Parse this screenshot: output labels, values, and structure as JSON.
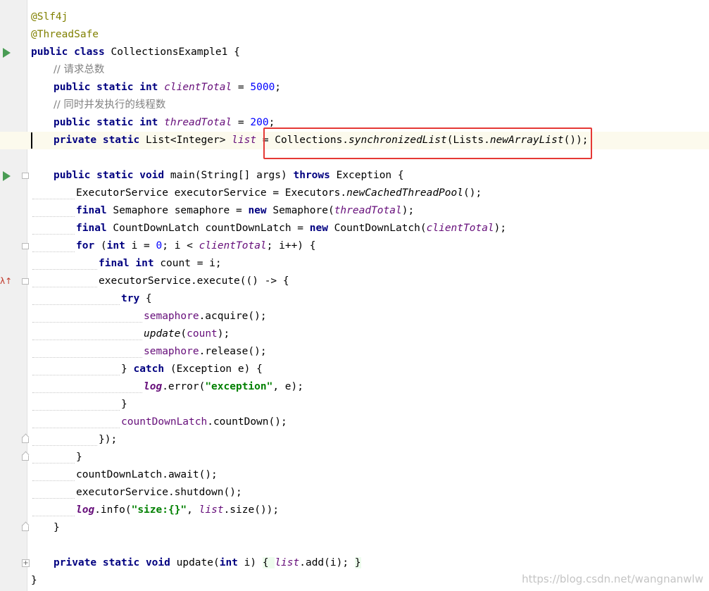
{
  "editor": {
    "lines": [
      {
        "indent": 0,
        "gutter": "",
        "tokens": [
          {
            "t": "anno",
            "v": "@Slf4j"
          }
        ]
      },
      {
        "indent": 0,
        "gutter": "",
        "tokens": [
          {
            "t": "anno",
            "v": "@ThreadSafe"
          }
        ]
      },
      {
        "indent": 0,
        "gutter": "run",
        "tokens": [
          {
            "t": "kw",
            "v": "public class "
          },
          {
            "t": "p",
            "v": "CollectionsExample1 {"
          }
        ]
      },
      {
        "indent": 1,
        "gutter": "",
        "tokens": [
          {
            "t": "cm",
            "v": "// 请求总数"
          }
        ]
      },
      {
        "indent": 1,
        "gutter": "",
        "tokens": [
          {
            "t": "kw",
            "v": "public static int "
          },
          {
            "t": "field",
            "v": "clientTotal"
          },
          {
            "t": "p",
            "v": " = "
          },
          {
            "t": "num",
            "v": "5000"
          },
          {
            "t": "p",
            "v": ";"
          }
        ]
      },
      {
        "indent": 1,
        "gutter": "",
        "tokens": [
          {
            "t": "cm",
            "v": "// 同时并发执行的线程数"
          }
        ]
      },
      {
        "indent": 1,
        "gutter": "",
        "tokens": [
          {
            "t": "kw",
            "v": "public static int "
          },
          {
            "t": "field",
            "v": "threadTotal"
          },
          {
            "t": "p",
            "v": " = "
          },
          {
            "t": "num",
            "v": "200"
          },
          {
            "t": "p",
            "v": ";"
          }
        ]
      },
      {
        "indent": 1,
        "gutter": "",
        "current": true,
        "tokens": [
          {
            "t": "kw",
            "v": "private static "
          },
          {
            "t": "p",
            "v": "List<Integer> "
          },
          {
            "t": "field",
            "v": "list"
          },
          {
            "t": "p",
            "v": " = Collections."
          },
          {
            "t": "static",
            "v": "synchronizedList"
          },
          {
            "t": "p",
            "v": "(Lists."
          },
          {
            "t": "static",
            "v": "newArrayList"
          },
          {
            "t": "p",
            "v": "());"
          }
        ]
      },
      {
        "indent": 0,
        "gutter": "",
        "tokens": []
      },
      {
        "indent": 1,
        "gutter": "run-fold",
        "tokens": [
          {
            "t": "kw",
            "v": "public static void "
          },
          {
            "t": "p",
            "v": "main(String[] args) "
          },
          {
            "t": "kw",
            "v": "throws "
          },
          {
            "t": "p",
            "v": "Exception {"
          }
        ]
      },
      {
        "indent": 2,
        "gutter": "",
        "guide": true,
        "tokens": [
          {
            "t": "p",
            "v": "ExecutorService executorService = Executors."
          },
          {
            "t": "static",
            "v": "newCachedThreadPool"
          },
          {
            "t": "p",
            "v": "();"
          }
        ]
      },
      {
        "indent": 2,
        "gutter": "",
        "guide": true,
        "tokens": [
          {
            "t": "kw",
            "v": "final "
          },
          {
            "t": "p",
            "v": "Semaphore semaphore = "
          },
          {
            "t": "kw",
            "v": "new "
          },
          {
            "t": "p",
            "v": "Semaphore("
          },
          {
            "t": "field",
            "v": "threadTotal"
          },
          {
            "t": "p",
            "v": ");"
          }
        ]
      },
      {
        "indent": 2,
        "gutter": "",
        "guide": true,
        "tokens": [
          {
            "t": "kw",
            "v": "final "
          },
          {
            "t": "p",
            "v": "CountDownLatch countDownLatch = "
          },
          {
            "t": "kw",
            "v": "new "
          },
          {
            "t": "p",
            "v": "CountDownLatch("
          },
          {
            "t": "field",
            "v": "clientTotal"
          },
          {
            "t": "p",
            "v": ");"
          }
        ]
      },
      {
        "indent": 2,
        "gutter": "fold",
        "guide": true,
        "tokens": [
          {
            "t": "kw",
            "v": "for "
          },
          {
            "t": "p",
            "v": "("
          },
          {
            "t": "kw",
            "v": "int "
          },
          {
            "t": "p",
            "v": "i = "
          },
          {
            "t": "num",
            "v": "0"
          },
          {
            "t": "p",
            "v": "; i < "
          },
          {
            "t": "field",
            "v": "clientTotal"
          },
          {
            "t": "p",
            "v": "; i++) {"
          }
        ]
      },
      {
        "indent": 3,
        "gutter": "",
        "guide": true,
        "tokens": [
          {
            "t": "kw",
            "v": "final int "
          },
          {
            "t": "p",
            "v": "count = i;"
          }
        ]
      },
      {
        "indent": 3,
        "gutter": "lambda-fold",
        "guide": true,
        "tokens": [
          {
            "t": "p",
            "v": "executorService.execute(() -> {"
          }
        ]
      },
      {
        "indent": 4,
        "gutter": "",
        "guide": true,
        "tokens": [
          {
            "t": "kw",
            "v": "try "
          },
          {
            "t": "p",
            "v": "{"
          }
        ]
      },
      {
        "indent": 5,
        "gutter": "",
        "guide": true,
        "tokens": [
          {
            "t": "ifield",
            "v": "semaphore"
          },
          {
            "t": "p",
            "v": ".acquire();"
          }
        ]
      },
      {
        "indent": 5,
        "gutter": "",
        "guide": true,
        "tokens": [
          {
            "t": "static",
            "v": "update"
          },
          {
            "t": "p",
            "v": "("
          },
          {
            "t": "ifield",
            "v": "count"
          },
          {
            "t": "p",
            "v": ");"
          }
        ]
      },
      {
        "indent": 5,
        "gutter": "",
        "guide": true,
        "tokens": [
          {
            "t": "ifield",
            "v": "semaphore"
          },
          {
            "t": "p",
            "v": ".release();"
          }
        ]
      },
      {
        "indent": 4,
        "gutter": "",
        "guide": true,
        "tokens": [
          {
            "t": "p",
            "v": "} "
          },
          {
            "t": "kw",
            "v": "catch "
          },
          {
            "t": "p",
            "v": "(Exception e) {"
          }
        ]
      },
      {
        "indent": 5,
        "gutter": "",
        "guide": true,
        "tokens": [
          {
            "t": "logv",
            "v": "log"
          },
          {
            "t": "p",
            "v": ".error("
          },
          {
            "t": "str",
            "v": "\"exception\""
          },
          {
            "t": "p",
            "v": ", e);"
          }
        ]
      },
      {
        "indent": 4,
        "gutter": "",
        "guide": true,
        "tokens": [
          {
            "t": "p",
            "v": "}"
          }
        ]
      },
      {
        "indent": 4,
        "gutter": "",
        "guide": true,
        "tokens": [
          {
            "t": "ifield",
            "v": "countDownLatch"
          },
          {
            "t": "p",
            "v": ".countDown();"
          }
        ]
      },
      {
        "indent": 3,
        "gutter": "fold-end",
        "guide": true,
        "tokens": [
          {
            "t": "p",
            "v": "});"
          }
        ]
      },
      {
        "indent": 2,
        "gutter": "fold-end",
        "guide": true,
        "tokens": [
          {
            "t": "p",
            "v": "}"
          }
        ]
      },
      {
        "indent": 2,
        "gutter": "",
        "guide": true,
        "tokens": [
          {
            "t": "p",
            "v": "countDownLatch.await();"
          }
        ]
      },
      {
        "indent": 2,
        "gutter": "",
        "guide": true,
        "tokens": [
          {
            "t": "p",
            "v": "executorService.shutdown();"
          }
        ]
      },
      {
        "indent": 2,
        "gutter": "",
        "guide": true,
        "tokens": [
          {
            "t": "logv",
            "v": "log"
          },
          {
            "t": "p",
            "v": ".info("
          },
          {
            "t": "str",
            "v": "\"size:{}\""
          },
          {
            "t": "p",
            "v": ", "
          },
          {
            "t": "field",
            "v": "list"
          },
          {
            "t": "p",
            "v": ".size());"
          }
        ]
      },
      {
        "indent": 1,
        "gutter": "fold-end",
        "tokens": [
          {
            "t": "p",
            "v": "}"
          }
        ]
      },
      {
        "indent": 0,
        "gutter": "",
        "tokens": []
      },
      {
        "indent": 1,
        "gutter": "fold-plus",
        "tokens": [
          {
            "t": "kw",
            "v": "private static void "
          },
          {
            "t": "p",
            "v": "update("
          },
          {
            "t": "kw",
            "v": "int "
          },
          {
            "t": "p",
            "v": "i) "
          },
          {
            "t": "lam",
            "v": "{ "
          },
          {
            "t": "field",
            "v": "list"
          },
          {
            "t": "p",
            "v": ".add(i); "
          },
          {
            "t": "lam",
            "v": "}"
          }
        ]
      },
      {
        "indent": 0,
        "gutter": "",
        "tokens": [
          {
            "t": "p",
            "v": "}"
          }
        ]
      }
    ]
  },
  "watermark": "https://blog.csdn.net/wangnanwlw",
  "colors": {
    "keyword": "#000080",
    "annotation": "#808000",
    "comment": "#808080",
    "number": "#0000ff",
    "field": "#660e7a",
    "string": "#008000",
    "highlight_box": "#e53935",
    "current_line": "#fcfaed"
  }
}
